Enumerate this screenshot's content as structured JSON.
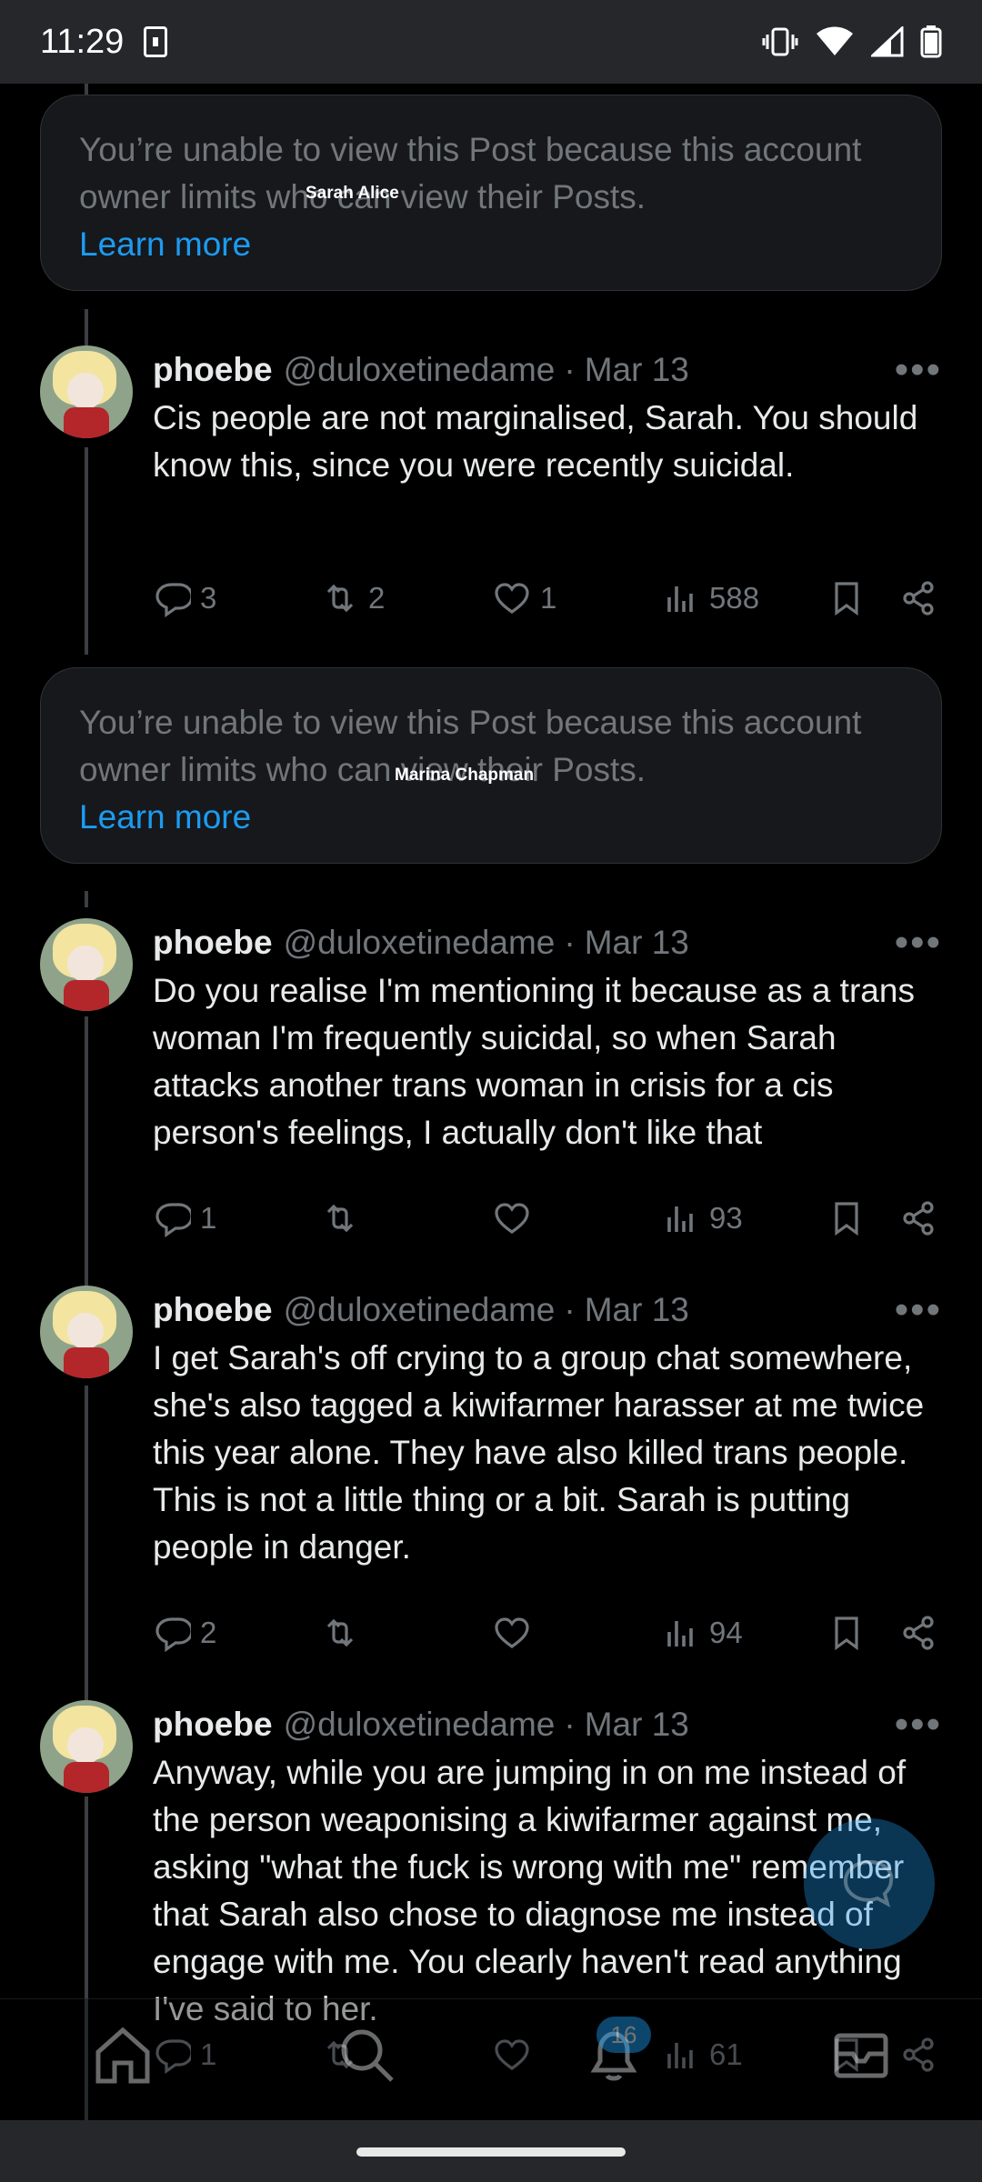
{
  "status_bar": {
    "time": "11:29"
  },
  "overlays": {
    "tag1": "Sarah Alice",
    "tag2": "Marina Chapman"
  },
  "notices": [
    {
      "text": "You’re unable to view this Post because this account owner limits who can view their Posts.",
      "link": "Learn more"
    },
    {
      "text": "You’re unable to view this Post because this account owner limits who can view their Posts.",
      "link": "Learn more"
    }
  ],
  "posts": [
    {
      "name": "phoebe",
      "handle": "@duloxetinedame",
      "dot": "·",
      "date": "Mar 13",
      "text": "Cis people are not marginalised, Sarah. You should know this, since you were recently suicidal.",
      "replies": "3",
      "reposts": "2",
      "likes": "1",
      "views": "588"
    },
    {
      "name": "phoebe",
      "handle": "@duloxetinedame",
      "dot": "·",
      "date": "Mar 13",
      "text": "Do you realise I'm mentioning it because as a trans woman I'm frequently suicidal, so when Sarah attacks another trans woman in crisis for a cis person's feelings, I actually don't like that",
      "replies": "1",
      "reposts": "",
      "likes": "",
      "views": "93"
    },
    {
      "name": "phoebe",
      "handle": "@duloxetinedame",
      "dot": "·",
      "date": "Mar 13",
      "text": "I get Sarah's off crying to a group chat somewhere, she's also tagged a kiwifarmer harasser at me twice this year alone. They have also killed trans people. This is not a little thing or a bit. Sarah is putting people in danger.",
      "replies": "2",
      "reposts": "",
      "likes": "",
      "views": "94"
    },
    {
      "name": "phoebe",
      "handle": "@duloxetinedame",
      "dot": "·",
      "date": "Mar 13",
      "text": "Anyway, while you are jumping in on me instead of the person weaponising a kiwifarmer against me, asking \"what the fuck is wrong with me\" remember that Sarah also chose to diagnose me instead of engage with me. You clearly haven't read anything I've said to her.",
      "replies": "1",
      "reposts": "",
      "likes": "",
      "views": "61"
    }
  ],
  "bottom_nav": {
    "notifications_badge": "16",
    "items": [
      "home-icon",
      "search-icon",
      "bell-icon",
      "mail-icon"
    ]
  },
  "colors": {
    "accent": "#1d9bf0",
    "muted": "#71767b",
    "text": "#e7e9ea",
    "background": "#000000"
  }
}
